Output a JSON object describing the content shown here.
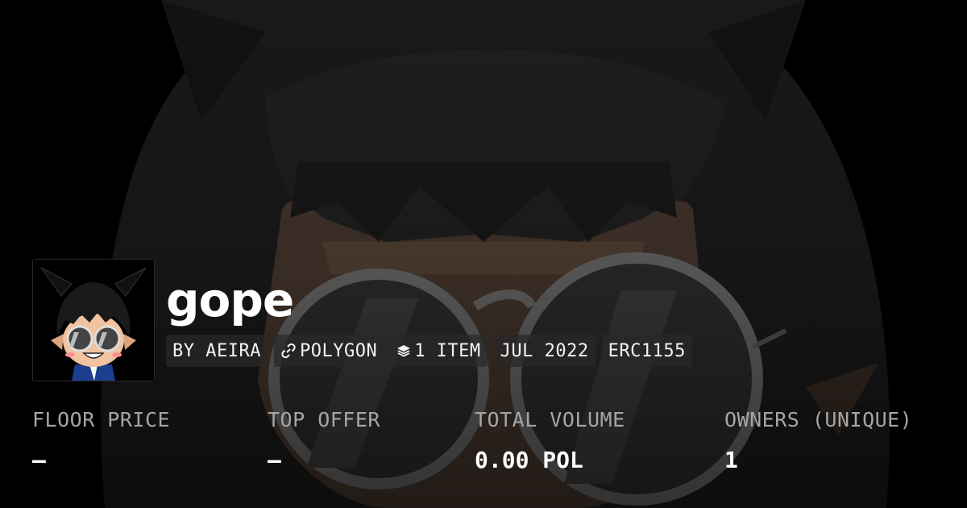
{
  "collection": {
    "name": "gope"
  },
  "chips": {
    "creator": "BY AEIRA",
    "chain": "POLYGON",
    "chain_icon": "polygon-link-icon",
    "items": "1 ITEM",
    "items_icon": "stack-layers-icon",
    "date": "JUL 2022",
    "standard": "ERC1155"
  },
  "stats": {
    "floor_price": {
      "label": "FLOOR PRICE",
      "value": "–"
    },
    "top_offer": {
      "label": "TOP OFFER",
      "value": "–"
    },
    "total_volume": {
      "label": "TOTAL VOLUME",
      "value": "0.00 POL"
    },
    "owners": {
      "label": "OWNERS (UNIQUE)",
      "value": "1"
    }
  },
  "colors": {
    "background": "#000000",
    "label_gray": "#a6a6a6",
    "chip_bg": "#282828"
  }
}
